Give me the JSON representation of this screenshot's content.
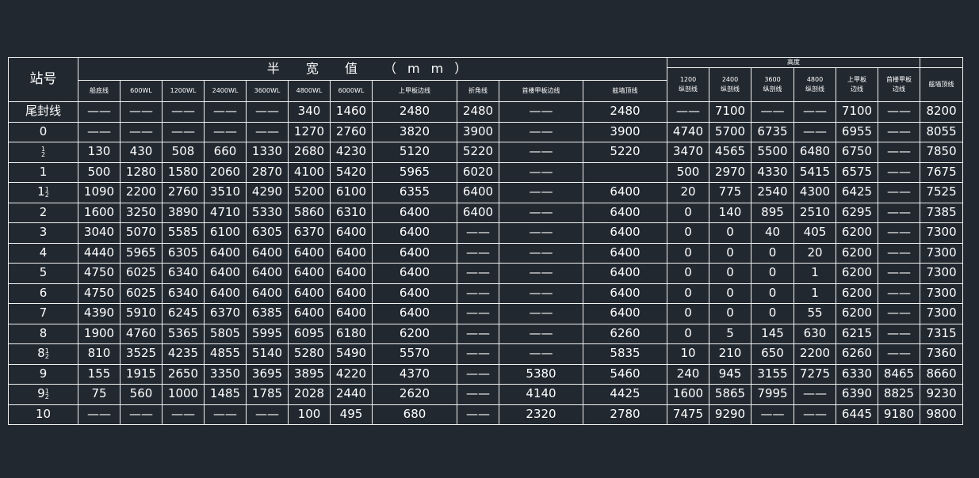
{
  "headers": {
    "station": "站号",
    "half_width": "半 宽 值   （mm）",
    "height": "高度",
    "cols": [
      "船底线",
      "600WL",
      "1200WL",
      "2400WL",
      "3600WL",
      "4800WL",
      "6000WL",
      "上甲板边线",
      "折角线",
      "首楼甲板边线",
      "舷墙顶线"
    ],
    "height_cols": [
      {
        "a": "1200",
        "b": "纵剖线"
      },
      {
        "a": "2400",
        "b": "纵剖线"
      },
      {
        "a": "3600",
        "b": "纵剖线"
      },
      {
        "a": "4800",
        "b": "纵剖线"
      },
      {
        "a": "上甲板",
        "b": "边线"
      },
      {
        "a": "首楼甲板",
        "b": "边线"
      }
    ],
    "last_col": "舷墙顶线"
  },
  "rows": [
    {
      "station": "尾封线",
      "cells": [
        "——",
        "——",
        "——",
        "——",
        "——",
        "340",
        "1460",
        "2480",
        "2480",
        "——",
        "2480",
        "——",
        "7100",
        "——",
        "——",
        "7100",
        "——",
        "8200"
      ]
    },
    {
      "station": "0",
      "cells": [
        "——",
        "——",
        "——",
        "——",
        "——",
        "1270",
        "2760",
        "3820",
        "3900",
        "——",
        "3900",
        "4740",
        "5700",
        "6735",
        "——",
        "6955",
        "——",
        "8055"
      ]
    },
    {
      "station": "",
      "frac": {
        "int": "",
        "num": "1",
        "den": "2"
      },
      "cells": [
        "130",
        "430",
        "508",
        "660",
        "1330",
        "2680",
        "4230",
        "5120",
        "5220",
        "——",
        "5220",
        "3470",
        "4565",
        "5500",
        "6480",
        "6750",
        "——",
        "7850"
      ]
    },
    {
      "station": "1",
      "cells": [
        "500",
        "1280",
        "1580",
        "2060",
        "2870",
        "4100",
        "5420",
        "5965",
        "6020",
        "——",
        "",
        "500",
        "2970",
        "4330",
        "5415",
        "6575",
        "——",
        "7675"
      ]
    },
    {
      "station": "",
      "frac": {
        "int": "1",
        "num": "1",
        "den": "2"
      },
      "cells": [
        "1090",
        "2200",
        "2760",
        "3510",
        "4290",
        "5200",
        "6100",
        "6355",
        "6400",
        "——",
        "6400",
        "20",
        "775",
        "2540",
        "4300",
        "6425",
        "——",
        "7525"
      ]
    },
    {
      "station": "2",
      "cells": [
        "1600",
        "3250",
        "3890",
        "4710",
        "5330",
        "5860",
        "6310",
        "6400",
        "6400",
        "——",
        "6400",
        "0",
        "140",
        "895",
        "2510",
        "6295",
        "——",
        "7385"
      ]
    },
    {
      "station": "3",
      "cells": [
        "3040",
        "5070",
        "5585",
        "6100",
        "6305",
        "6370",
        "6400",
        "6400",
        "——",
        "——",
        "6400",
        "0",
        "0",
        "40",
        "405",
        "6200",
        "——",
        "7300"
      ]
    },
    {
      "station": "4",
      "cells": [
        "4440",
        "5965",
        "6305",
        "6400",
        "6400",
        "6400",
        "6400",
        "6400",
        "——",
        "——",
        "6400",
        "0",
        "0",
        "0",
        "20",
        "6200",
        "——",
        "7300"
      ]
    },
    {
      "station": "5",
      "cells": [
        "4750",
        "6025",
        "6340",
        "6400",
        "6400",
        "6400",
        "6400",
        "6400",
        "——",
        "——",
        "6400",
        "0",
        "0",
        "0",
        "1",
        "6200",
        "——",
        "7300"
      ]
    },
    {
      "station": "6",
      "cells": [
        "4750",
        "6025",
        "6340",
        "6400",
        "6400",
        "6400",
        "6400",
        "6400",
        "——",
        "——",
        "6400",
        "0",
        "0",
        "0",
        "1",
        "6200",
        "——",
        "7300"
      ]
    },
    {
      "station": "7",
      "cells": [
        "4390",
        "5910",
        "6245",
        "6370",
        "6385",
        "6400",
        "6400",
        "6400",
        "——",
        "——",
        "6400",
        "0",
        "0",
        "0",
        "55",
        "6200",
        "——",
        "7300"
      ]
    },
    {
      "station": "8",
      "cells": [
        "1900",
        "4760",
        "5365",
        "5805",
        "5995",
        "6095",
        "6180",
        "6200",
        "——",
        "——",
        "6260",
        "0",
        "5",
        "145",
        "630",
        "6215",
        "——",
        "7315"
      ]
    },
    {
      "station": "",
      "frac": {
        "int": "8",
        "num": "1",
        "den": "2"
      },
      "cells": [
        "810",
        "3525",
        "4235",
        "4855",
        "5140",
        "5280",
        "5490",
        "5570",
        "——",
        "——",
        "5835",
        "10",
        "210",
        "650",
        "2200",
        "6260",
        "——",
        "7360"
      ]
    },
    {
      "station": "9",
      "cells": [
        "155",
        "1915",
        "2650",
        "3350",
        "3695",
        "3895",
        "4220",
        "4370",
        "——",
        "5380",
        "5460",
        "240",
        "945",
        "3155",
        "7275",
        "6330",
        "8465",
        "8660"
      ]
    },
    {
      "station": "",
      "frac": {
        "int": "9",
        "num": "1",
        "den": "2"
      },
      "cells": [
        "75",
        "560",
        "1000",
        "1485",
        "1785",
        "2028",
        "2440",
        "2620",
        "——",
        "4140",
        "4425",
        "1600",
        "5865",
        "7995",
        "——",
        "6390",
        "8825",
        "9230"
      ]
    },
    {
      "station": "10",
      "cells": [
        "——",
        "——",
        "——",
        "——",
        "——",
        "100",
        "495",
        "680",
        "——",
        "2320",
        "2780",
        "7475",
        "9290",
        "——",
        "——",
        "6445",
        "9180",
        "9800"
      ]
    }
  ]
}
